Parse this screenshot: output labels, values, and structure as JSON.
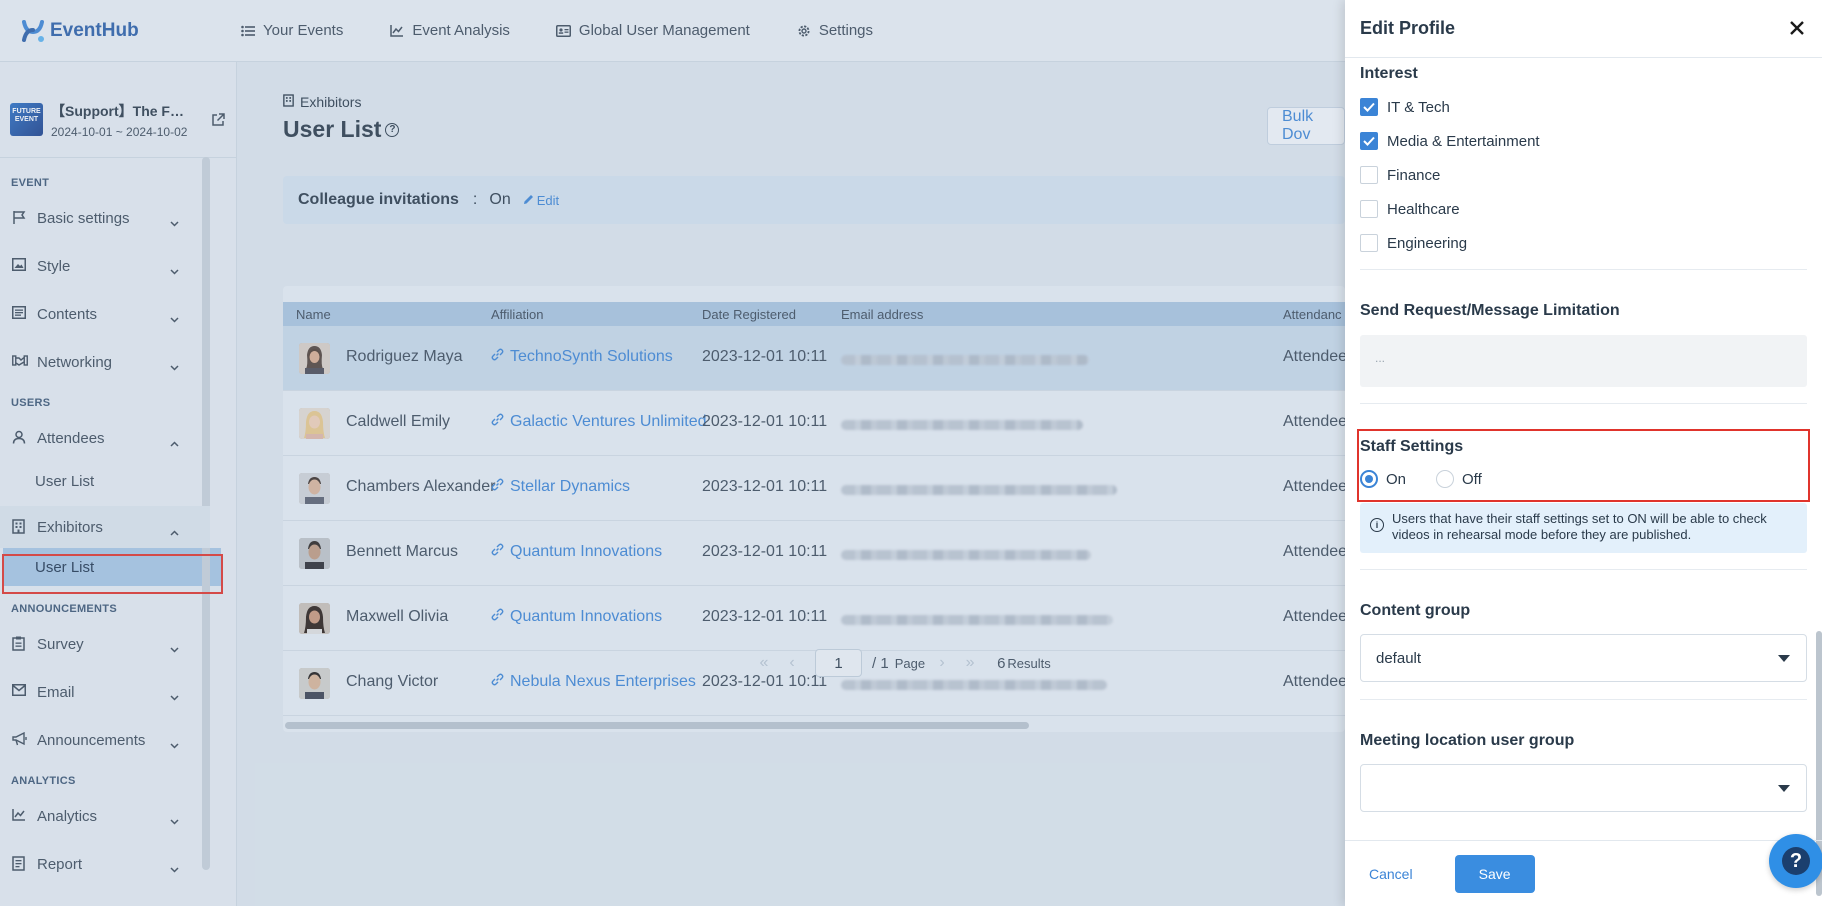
{
  "app": {
    "name": "EventHub"
  },
  "topnav": [
    {
      "label": "Your Events",
      "icon": "list-icon"
    },
    {
      "label": "Event Analysis",
      "icon": "chart-line-icon"
    },
    {
      "label": "Global User Management",
      "icon": "id-card-icon"
    },
    {
      "label": "Settings",
      "icon": "gear-icon"
    }
  ],
  "event": {
    "thumb_text": "FUTURE EVENT",
    "title": "【Support】The F…",
    "dates": "2024-10-01 ~ 2024-10-02"
  },
  "sidebar": {
    "sections": {
      "event": "EVENT",
      "users": "USERS",
      "announcements": "ANNOUNCEMENTS",
      "analytics": "ANALYTICS"
    },
    "items": {
      "basic_settings": "Basic settings",
      "style": "Style",
      "contents": "Contents",
      "networking": "Networking",
      "attendees": "Attendees",
      "attendees_user_list": "User List",
      "exhibitors": "Exhibitors",
      "exhibitors_user_list": "User List",
      "survey": "Survey",
      "email": "Email",
      "announcements": "Announcements",
      "analytics": "Analytics",
      "report": "Report"
    }
  },
  "main": {
    "breadcrumb": "Exhibitors",
    "title": "User List",
    "bulk_button": "Bulk Dov",
    "colleague": {
      "label": "Colleague invitations",
      "separator": ":",
      "value": "On",
      "edit": "Edit"
    },
    "table": {
      "headers": [
        "Name",
        "Affiliation",
        "Date Registered",
        "Email address",
        "Attendanc"
      ],
      "rows": [
        {
          "name": "Rodriguez Maya",
          "affiliation": "TechnoSynth Solutions",
          "date": "2023-12-01 10:11",
          "role": "Attendee"
        },
        {
          "name": "Caldwell Emily",
          "affiliation": "Galactic Ventures Unlimited",
          "date": "2023-12-01 10:11",
          "role": "Attendee"
        },
        {
          "name": "Chambers Alexander",
          "affiliation": "Stellar Dynamics",
          "date": "2023-12-01 10:11",
          "role": "Attendee"
        },
        {
          "name": "Bennett Marcus",
          "affiliation": "Quantum Innovations",
          "date": "2023-12-01 10:11",
          "role": "Attendee"
        },
        {
          "name": "Maxwell Olivia",
          "affiliation": "Quantum Innovations",
          "date": "2023-12-01 10:11",
          "role": "Attendee"
        },
        {
          "name": "Chang Victor",
          "affiliation": "Nebula Nexus Enterprises",
          "date": "2023-12-01 10:11",
          "role": "Attendee"
        }
      ]
    },
    "pager": {
      "current": "1",
      "of": "/ 1",
      "page_word": "Page",
      "count": "6",
      "results_word": "Results"
    }
  },
  "drawer": {
    "title": "Edit Profile",
    "interest": {
      "title": "Interest",
      "options": [
        {
          "label": "IT & Tech",
          "checked": true
        },
        {
          "label": "Media & Entertainment",
          "checked": true
        },
        {
          "label": "Finance",
          "checked": false
        },
        {
          "label": "Healthcare",
          "checked": false
        },
        {
          "label": "Engineering",
          "checked": false
        }
      ]
    },
    "limit": {
      "title": "Send Request/Message Limitation",
      "placeholder": "..."
    },
    "staff": {
      "title": "Staff Settings",
      "on": "On",
      "off": "Off",
      "selected": "On",
      "info": "Users that have their staff settings set to ON will be able to check videos in rehearsal mode before they are published."
    },
    "content_group": {
      "title": "Content group",
      "value": "default"
    },
    "meeting_group": {
      "title": "Meeting location user group",
      "value": ""
    },
    "cancel": "Cancel",
    "save": "Save"
  },
  "colors": {
    "accent": "#3b84d6",
    "highlight_box": "#e0342c",
    "sidebar_active": "#a6c6e4"
  }
}
